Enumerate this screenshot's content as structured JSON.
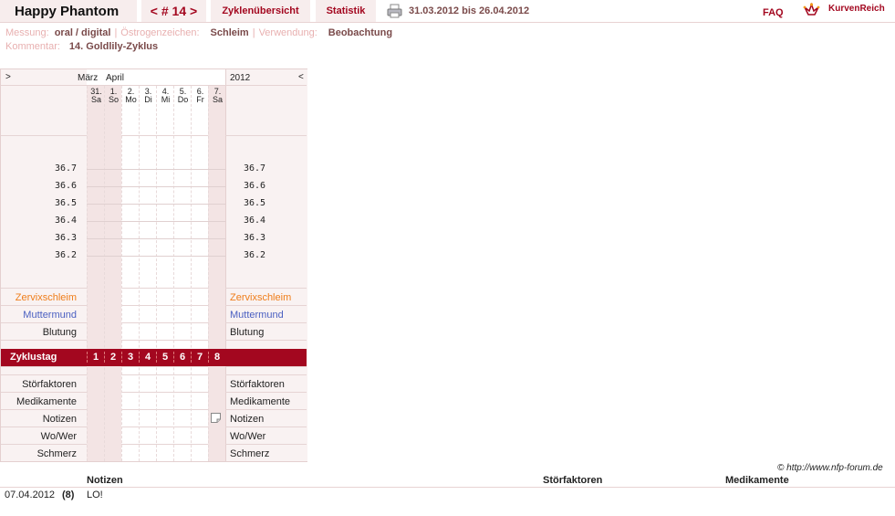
{
  "header": {
    "user": "Happy Phantom",
    "cycle_nav": "< # 14 >",
    "tab_overview": "Zyklenübersicht",
    "tab_stats": "Statistik",
    "date_range": "31.03.2012 bis 26.04.2012",
    "faq": "FAQ",
    "brand": "KurvenReich",
    "print_icon": "printer-icon"
  },
  "meta": {
    "measure_label": "Messung:",
    "measure_value": "oral / digital",
    "estrogen_label": "Östrogenzeichen:",
    "estrogen_value": "Schleim",
    "usage_label": "Verwendung:",
    "usage_value": "Beobachtung",
    "comment_label": "Kommentar:",
    "comment_value": "14. Goldlily-Zyklus"
  },
  "chart": {
    "nav_left": ">",
    "nav_right": "<",
    "month1": "März",
    "month2": "April",
    "year": "2012",
    "days": [
      {
        "num": "31.",
        "dow": "Sa"
      },
      {
        "num": "1.",
        "dow": "So"
      },
      {
        "num": "2.",
        "dow": "Mo"
      },
      {
        "num": "3.",
        "dow": "Di"
      },
      {
        "num": "4.",
        "dow": "Mi"
      },
      {
        "num": "5.",
        "dow": "Do"
      },
      {
        "num": "6.",
        "dow": "Fr"
      },
      {
        "num": "7.",
        "dow": "Sa"
      }
    ],
    "temps": [
      "36.7",
      "36.6",
      "36.5",
      "36.4",
      "36.3",
      "36.2"
    ],
    "rows": {
      "cervix": "Zervixschleim",
      "os": "Muttermund",
      "bleeding": "Blutung",
      "cycleday": "Zyklustag",
      "disturb": "Störfaktoren",
      "meds": "Medikamente",
      "notes": "Notizen",
      "where": "Wo/Wer",
      "pain": "Schmerz"
    },
    "cycle_days": [
      "1",
      "2",
      "3",
      "4",
      "5",
      "6",
      "7",
      "8"
    ]
  },
  "footer": {
    "copyright": "© http://www.nfp-forum.de",
    "col_notes": "Notizen",
    "col_disturb": "Störfaktoren",
    "col_meds": "Medikamente",
    "row_date": "07.04.2012",
    "row_day": "(8)",
    "row_note": "LO!"
  }
}
